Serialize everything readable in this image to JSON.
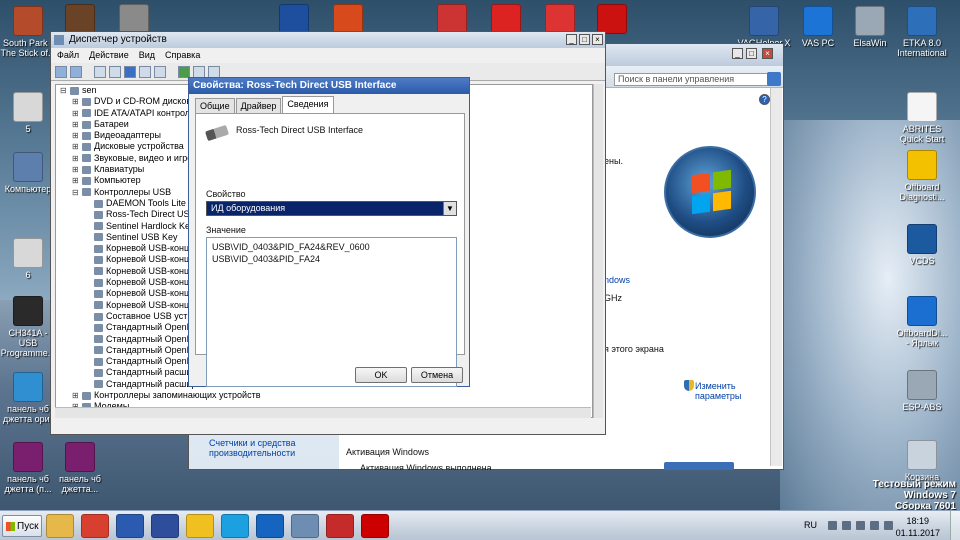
{
  "desktop": {
    "icons_left": [
      {
        "label": "South Park - The Stick of...",
        "color": "#b44b2a"
      },
      {
        "label": "5",
        "color": "#d8d8d8"
      },
      {
        "label": "Компьютер",
        "color": "#5d7fae"
      },
      {
        "label": "6",
        "color": "#d8d8d8"
      },
      {
        "label": "CH341A - USB Programme...",
        "color": "#2a2a2a"
      },
      {
        "label": "панель чб джетта ориг",
        "color": "#2f8fd1"
      },
      {
        "label": "панель чб джетта (п...",
        "color": "#7a1f6e"
      },
      {
        "label": "панель чб джетта...",
        "color": "#7a1f6e"
      }
    ],
    "icons_top": [
      {
        "label": "",
        "color": "#6a4226"
      },
      {
        "label": "",
        "color": "#8a8a8a"
      },
      {
        "label": "",
        "color": "#1e4f9e"
      },
      {
        "label": "",
        "color": "#d64a1b"
      },
      {
        "label": "",
        "color": "#c33"
      },
      {
        "label": "",
        "color": "#d22"
      },
      {
        "label": "",
        "color": "#d33"
      },
      {
        "label": "",
        "color": "#c11"
      }
    ],
    "icons_right_top": [
      {
        "label": "VAGHelper.X",
        "color": "#3565a8"
      },
      {
        "label": "VAS PC",
        "color": "#1b74d6"
      },
      {
        "label": "ElsaWin",
        "color": "#9aa7b5"
      },
      {
        "label": "ETKA 8.0 International",
        "color": "#2d6fb8"
      }
    ],
    "icons_right": [
      {
        "label": "ABRITES Quick Start",
        "color": "#f5f5f5"
      },
      {
        "label": "Offboard Diagnosti...",
        "color": "#f3c100"
      },
      {
        "label": "VCDS",
        "color": "#1c5aa0"
      },
      {
        "label": "OffboardDi... - Ярлык",
        "color": "#1a6fd1"
      },
      {
        "label": "ESP-ABS",
        "color": "#9aa7b5"
      },
      {
        "label": "Корзина",
        "color": "#c9d3dd"
      }
    ],
    "watermark": [
      "Тестовый режим",
      "Windows 7",
      "Сборка 7601"
    ]
  },
  "device_manager": {
    "title": "Диспетчер устройств",
    "menu": [
      "Файл",
      "Действие",
      "Вид",
      "Справка"
    ],
    "tree": [
      {
        "text": "sen",
        "level": 0,
        "exp": "⊟"
      },
      {
        "text": "DVD и CD-ROM дисководы",
        "level": 1,
        "exp": "⊞"
      },
      {
        "text": "IDE ATA/ATAPI контроллеры",
        "level": 1,
        "exp": "⊞"
      },
      {
        "text": "Батареи",
        "level": 1,
        "exp": "⊞"
      },
      {
        "text": "Видеоадаптеры",
        "level": 1,
        "exp": "⊞"
      },
      {
        "text": "Дисковые устройства",
        "level": 1,
        "exp": "⊞"
      },
      {
        "text": "Звуковые, видео и игровые устройства",
        "level": 1,
        "exp": "⊞"
      },
      {
        "text": "Клавиатуры",
        "level": 1,
        "exp": "⊞"
      },
      {
        "text": "Компьютер",
        "level": 1,
        "exp": "⊞"
      },
      {
        "text": "Контроллеры USB",
        "level": 1,
        "exp": "⊟"
      },
      {
        "text": "DAEMON Tools Lite Virtual USB Bus",
        "level": 2,
        "exp": ""
      },
      {
        "text": "Ross-Tech Direct USB Interface",
        "level": 2,
        "exp": ""
      },
      {
        "text": "Sentinel Hardlock Key",
        "level": 2,
        "exp": ""
      },
      {
        "text": "Sentinel USB Key",
        "level": 2,
        "exp": ""
      },
      {
        "text": "Корневой USB-концентратор",
        "level": 2,
        "exp": ""
      },
      {
        "text": "Корневой USB-концентратор",
        "level": 2,
        "exp": ""
      },
      {
        "text": "Корневой USB-концентратор",
        "level": 2,
        "exp": ""
      },
      {
        "text": "Корневой USB-концентратор",
        "level": 2,
        "exp": ""
      },
      {
        "text": "Корневой USB-концентратор",
        "level": 2,
        "exp": ""
      },
      {
        "text": "Корневой USB-концентратор",
        "level": 2,
        "exp": ""
      },
      {
        "text": "Составное USB устройство",
        "level": 2,
        "exp": ""
      },
      {
        "text": "Стандартный OpenHCD USB хост-контроллер",
        "level": 2,
        "exp": ""
      },
      {
        "text": "Стандартный OpenHCD USB хост-контроллер",
        "level": 2,
        "exp": ""
      },
      {
        "text": "Стандартный OpenHCD USB хост-контроллер",
        "level": 2,
        "exp": ""
      },
      {
        "text": "Стандартный OpenHCD USB хост-контроллер",
        "level": 2,
        "exp": ""
      },
      {
        "text": "Стандартный расширенный PCI-USB",
        "level": 2,
        "exp": ""
      },
      {
        "text": "Стандартный расширенный PCI-USB",
        "level": 2,
        "exp": ""
      },
      {
        "text": "Контроллеры запоминающих устройств",
        "level": 1,
        "exp": "⊞"
      },
      {
        "text": "Модемы",
        "level": 1,
        "exp": "⊞"
      },
      {
        "text": "Мониторы",
        "level": 1,
        "exp": "⊞"
      }
    ]
  },
  "control_panel": {
    "search_placeholder": "Поиск в панели управления",
    "frag1": "ены.",
    "frag2": "ndows",
    "frag3": "GHz",
    "frag4": "я этого экрана",
    "change_params": "Изменить параметры",
    "counters_link": "Счетчики и средства производительности",
    "activation_header": "Активация Windows",
    "activation_status": "Активация Windows выполнена"
  },
  "dialog": {
    "title": "Свойства: Ross-Tech Direct USB Interface",
    "tabs": [
      "Общие",
      "Драйвер",
      "Сведения"
    ],
    "device_name": "Ross-Tech Direct USB Interface",
    "property_label": "Свойство",
    "property_value": "ИД оборудования",
    "value_label": "Значение",
    "values": [
      "USB\\VID_0403&PID_FA24&REV_0600",
      "USB\\VID_0403&PID_FA24"
    ],
    "ok": "OK",
    "cancel": "Отмена"
  },
  "taskbar": {
    "start": "Пуск",
    "lang": "RU",
    "time": "18:19",
    "date": "01.11.2017",
    "apps": [
      {
        "name": "explorer",
        "color": "#e6b84a"
      },
      {
        "name": "chrome",
        "color": "#d7402f"
      },
      {
        "name": "word",
        "color": "#2b5bb0"
      },
      {
        "name": "save",
        "color": "#2e4e9c"
      },
      {
        "name": "archicad",
        "color": "#f0c020"
      },
      {
        "name": "skype",
        "color": "#1ca0e0"
      },
      {
        "name": "teamviewer",
        "color": "#1565c0"
      },
      {
        "name": "devices",
        "color": "#6d8db3"
      },
      {
        "name": "toolbox",
        "color": "#c62b2b"
      },
      {
        "name": "record",
        "color": "#c00"
      }
    ]
  }
}
